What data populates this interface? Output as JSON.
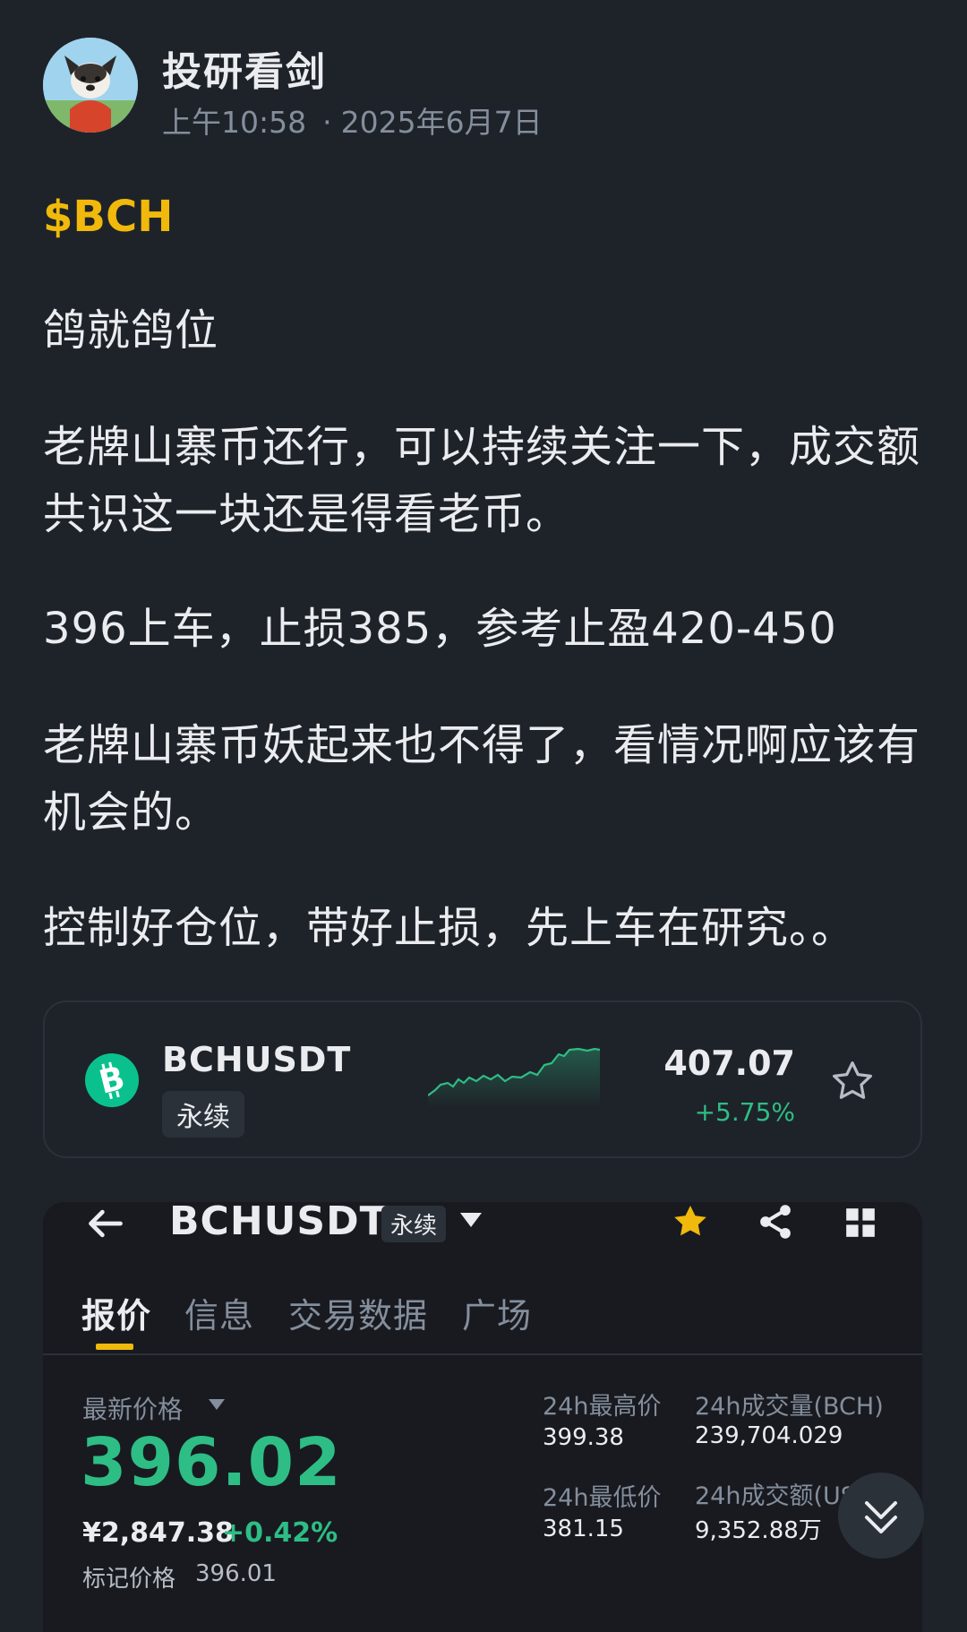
{
  "post": {
    "author": "投研看剑",
    "time": "上午10:58",
    "date": "2025年6月7日",
    "ticker_tag": "$BCH",
    "paragraphs": [
      "鸽就鸽位",
      "老牌山寨币还行，可以持续关注一下，成交额共识这一块还是得看老币。",
      "396上车，止损385，参考止盈420-450",
      "老牌山寨币妖起来也不得了，看情况啊应该有机会的。",
      "控制好仓位，带好止损，先上车在研究。。"
    ]
  },
  "coin_card": {
    "symbol": "BCHUSDT",
    "badge": "永续",
    "price": "407.07",
    "change": "+5.75%",
    "sparkline_icon": "uptrend-sparkline",
    "sparkline_color": "#2ebd85"
  },
  "embed": {
    "symbol": "BCHUSDT",
    "badge": "永续",
    "tabs": [
      "报价",
      "信息",
      "交易数据",
      "广场"
    ],
    "active_tab": 0,
    "latest_label": "最新价格",
    "latest_price": "396.02",
    "cny_price": "¥2,847.38",
    "cny_change": "+0.42%",
    "mark_label": "标记价格",
    "mark_value": "396.01",
    "stats": {
      "high_label": "24h最高价",
      "high_value": "399.38",
      "low_label": "24h最低价",
      "low_value": "381.15",
      "vol_label": "24h成交量(BCH)",
      "vol_value": "239,704.029",
      "turnover_label": "24h成交额(USDT)",
      "turnover_value": "9,352.88万"
    }
  },
  "colors": {
    "background": "#1e2329",
    "accent": "#f0b90b",
    "up": "#2ebd85",
    "muted": "#848e9c"
  }
}
